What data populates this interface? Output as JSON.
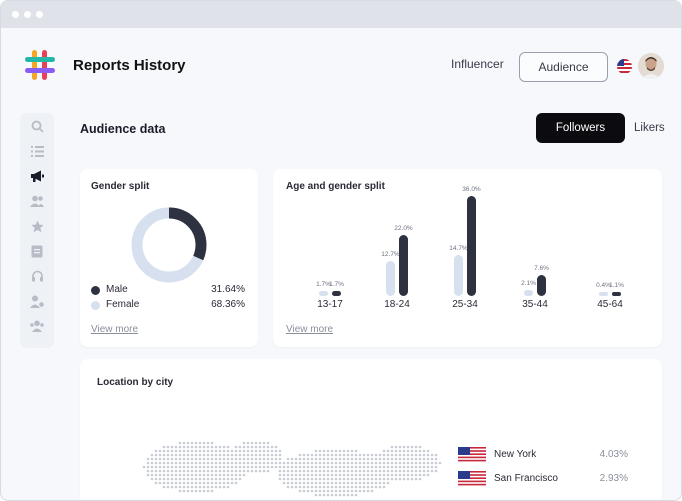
{
  "app": {
    "title": "Reports History",
    "nav": {
      "influencer_label": "Influencer",
      "audience_label": "Audience"
    }
  },
  "sidebar": {
    "icons": [
      "search-icon",
      "list-icon",
      "megaphone-icon",
      "users-icon",
      "star-icon",
      "document-icon",
      "headset-icon",
      "user-settings-icon",
      "group-icon"
    ]
  },
  "main": {
    "section_title": "Audience data",
    "tabs": {
      "followers_label": "Followers",
      "likers_label": "Likers",
      "active": "Followers"
    },
    "gender_split": {
      "title": "Gender split",
      "items": [
        {
          "label": "Male",
          "value": "31.64%",
          "color": "#2e3240"
        },
        {
          "label": "Female",
          "value": "68.36%",
          "color": "#d6e0ee"
        }
      ],
      "view_more": "View more"
    },
    "age_gender_split": {
      "title": "Age and gender split",
      "view_more": "View more"
    },
    "location": {
      "title": "Location by city",
      "cities": [
        {
          "name": "New York",
          "value": "4.03%"
        },
        {
          "name": "San Francisco",
          "value": "2.93%"
        }
      ]
    }
  },
  "colors": {
    "dark": "#2e3240",
    "light": "#d6e0ee",
    "accent_black": "#0c0c10"
  },
  "chart_data": {
    "type": "bar",
    "categories": [
      "13-17",
      "18-24",
      "25-34",
      "35-44",
      "45-64"
    ],
    "series": [
      {
        "values": [
          1.7,
          12.7,
          14.7,
          2.1,
          0.4
        ],
        "labels": [
          "1.7%",
          "12.7%",
          "14.7%",
          "2.1%",
          "0.4%"
        ]
      },
      {
        "values": [
          1.7,
          22.0,
          36.0,
          7.6,
          1.1
        ],
        "labels": [
          "1.7%",
          "22.0%",
          "36.0%",
          "7.6%",
          "1.1%"
        ]
      }
    ],
    "title": "Age and gender split",
    "ylim": [
      0,
      36
    ]
  }
}
